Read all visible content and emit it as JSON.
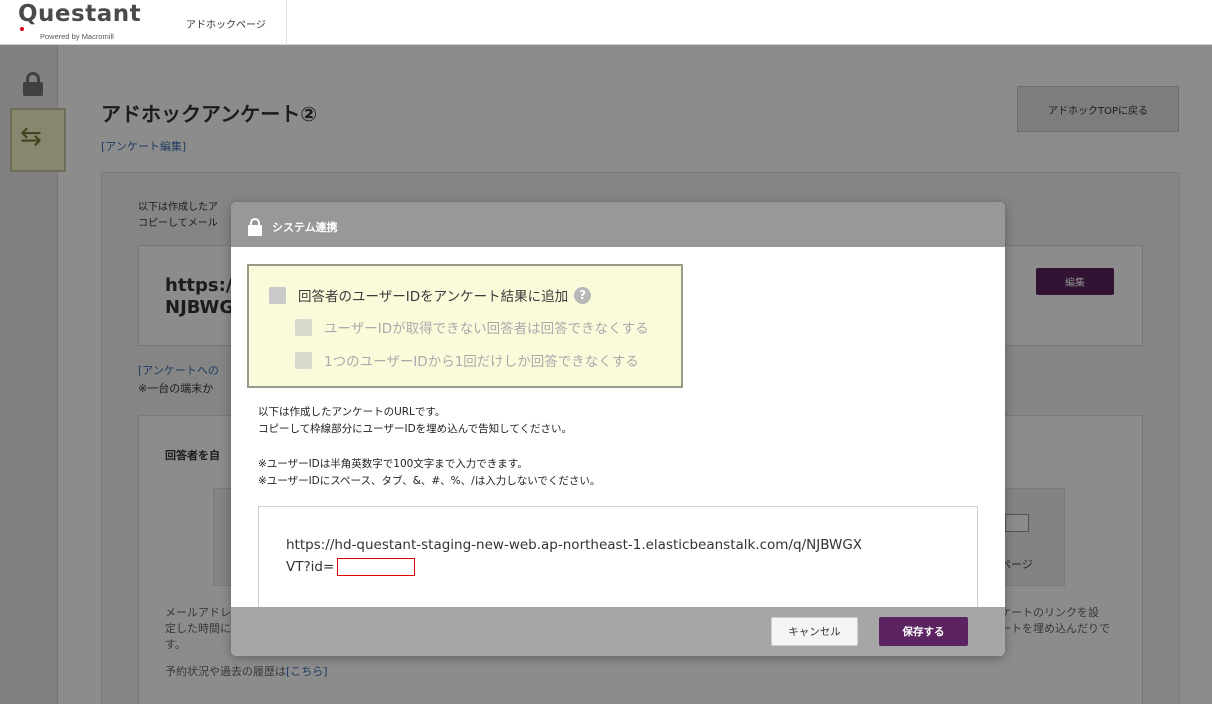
{
  "header": {
    "logo_text": "Questant",
    "logo_sub": "Powered by Macromill",
    "page_label": "アドホックページ"
  },
  "page": {
    "title": "アドホックアンケート②",
    "edit_link": "[アンケート編集]",
    "top_button": "アドホックTOPに戻る",
    "intro_line1": "以下は作成したア",
    "intro_line2": "コピーしてメール",
    "url_big_line1": "https:/",
    "url_big_line2": "NJBWG",
    "edit_button": "編集",
    "survey_link": "[アンケートへの",
    "note_line": "※一台の端末か",
    "inner_heading": "回答者を自",
    "card_right_label": "ページ",
    "left_bottom_line1": "メールアドレ",
    "left_bottom_line2": "定した時間に",
    "left_bottom_line3": "す。",
    "right_bottom_line1": "ケートのリンクを設",
    "right_bottom_line2": "ートを埋め込んだりで",
    "history_prefix": "予約状況や過去の履歴は",
    "history_link": "[こちら]"
  },
  "modal": {
    "title": "システム連携",
    "options": {
      "main_label": "回答者のユーザーIDをアンケート結果に追加",
      "help": "?",
      "sub1_label": "ユーザーIDが取得できない回答者は回答できなくする",
      "sub2_label": "1つのユーザーIDから1回だけしか回答できなくする"
    },
    "desc_line1": "以下は作成したアンケートのURLです。",
    "desc_line2": "コピーして枠線部分にユーザーIDを埋め込んで告知してください。",
    "note_line1": "※ユーザーIDは半角英数字で100文字まで入力できます。",
    "note_line2": "※ユーザーIDにスペース、タブ、&、#、%、/は入力しないでください。",
    "url_line1": "https://hd-questant-staging-new-web.ap-northeast-1.elasticbeanstalk.com/q/NJBWGX",
    "url_line2": "VT?id=",
    "cancel_button": "キャンセル",
    "save_button": "保存する"
  }
}
